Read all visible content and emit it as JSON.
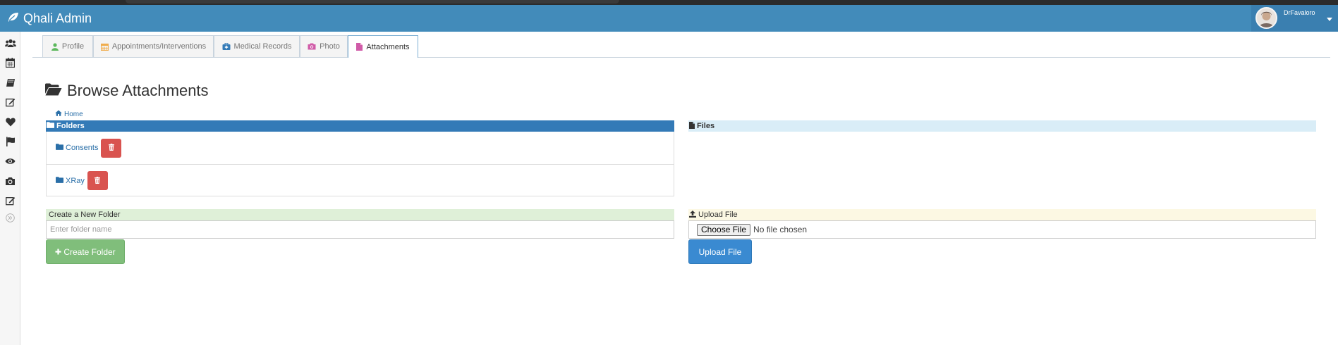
{
  "app": {
    "title": "Qhali Admin"
  },
  "user": {
    "name": "DrFavaloro"
  },
  "sidebar": {
    "icons": [
      "users-icon",
      "calendar-icon",
      "book-icon",
      "edit-icon",
      "heart-icon",
      "flag-icon",
      "eye-icon",
      "camera-icon",
      "edit-icon",
      "expand-icon"
    ]
  },
  "tabs": [
    {
      "label": "Profile",
      "icon": "user-icon",
      "color": "#5cb85c"
    },
    {
      "label": "Appointments/Interventions",
      "icon": "calendar-icon",
      "color": "#f0ad4e"
    },
    {
      "label": "Medical Records",
      "icon": "medkit-icon",
      "color": "#337ab7"
    },
    {
      "label": "Photo",
      "icon": "camera-icon",
      "color": "#d05ba8"
    },
    {
      "label": "Attachments",
      "icon": "file-icon",
      "color": "#d05ba8"
    }
  ],
  "page": {
    "title": "Browse Attachments"
  },
  "breadcrumb": {
    "home": "Home"
  },
  "folders": {
    "header": "Folders",
    "items": [
      {
        "name": "Consents"
      },
      {
        "name": "XRay"
      }
    ]
  },
  "files": {
    "header": "Files"
  },
  "new_folder": {
    "header": "Create a New Folder",
    "placeholder": "Enter folder name",
    "button": "Create Folder"
  },
  "upload": {
    "header": "Upload File",
    "choose_label": "Choose File",
    "no_file_text": "No file chosen",
    "button": "Upload File"
  }
}
